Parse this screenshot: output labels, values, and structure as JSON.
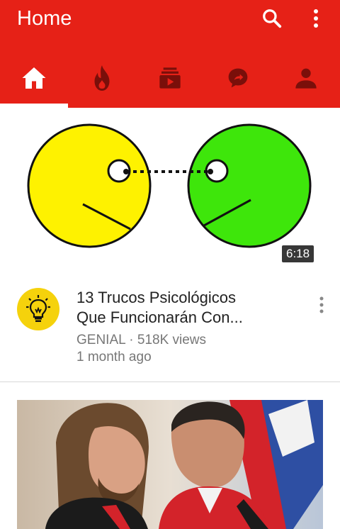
{
  "app": {
    "title": "Home"
  },
  "header": {
    "icons": {
      "search": "search-icon",
      "more": "more-vert-icon"
    }
  },
  "tabs": [
    {
      "name": "home",
      "icon": "home-icon",
      "active": true
    },
    {
      "name": "trending",
      "icon": "trending-flame-icon",
      "active": false
    },
    {
      "name": "subscriptions",
      "icon": "subscriptions-icon",
      "active": false
    },
    {
      "name": "activity",
      "icon": "activity-share-icon",
      "active": false
    },
    {
      "name": "account",
      "icon": "account-icon",
      "active": false
    }
  ],
  "colors": {
    "brand": "#e62117",
    "text": "#222222",
    "muted": "#777777"
  },
  "videos": [
    {
      "duration": "6:18",
      "title_line1": "13 Trucos Psicológicos",
      "title_line2": "Que Funcionarán Con...",
      "channel": "GENIAL",
      "views": "518K views",
      "meta_line1": "GENIAL · 518K views",
      "age": "1 month ago"
    },
    {
      "thumbnail": "two-men-in-racing-suits"
    }
  ]
}
